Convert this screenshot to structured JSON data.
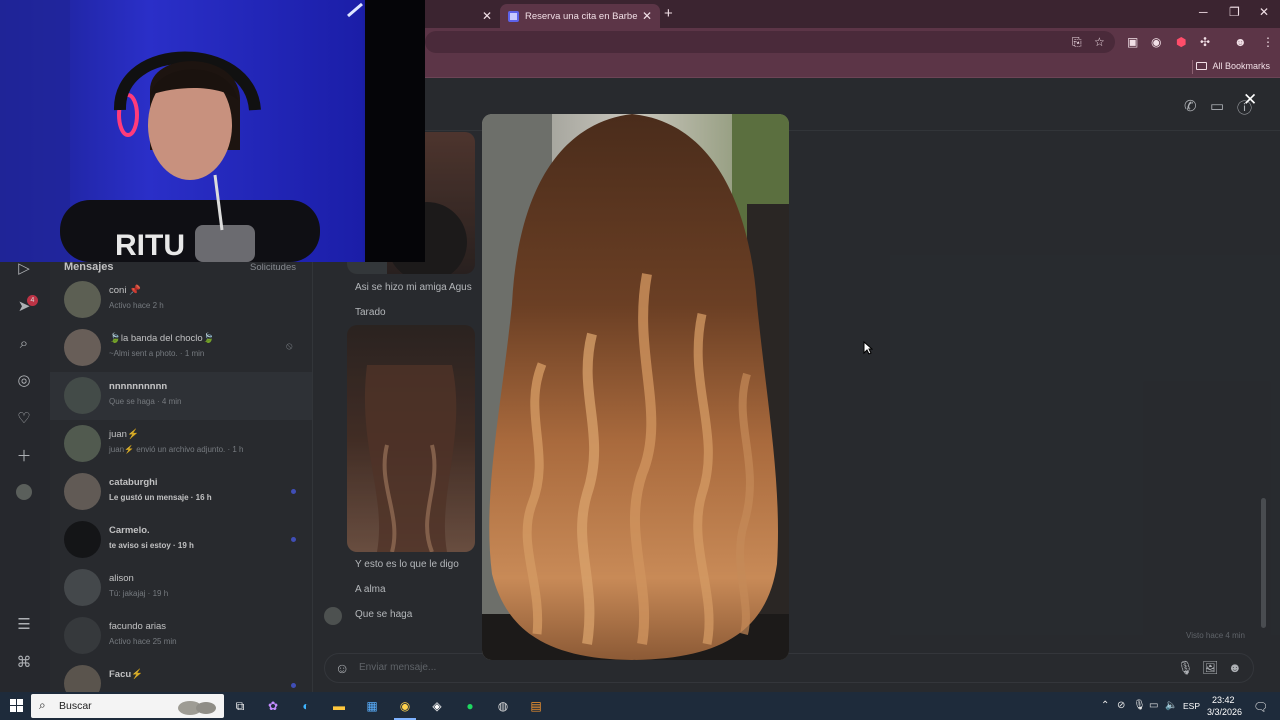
{
  "browser": {
    "tabs": [
      {
        "title": ""
      },
      {
        "title": "Reserva una cita en Barbería D…"
      }
    ],
    "new_tab": "+",
    "bookmarks_all": "All Bookmarks"
  },
  "inbox": {
    "title": "Mensajes",
    "requests": "Solicitudes",
    "conversations": [
      {
        "name": "coni 📌",
        "sub": "Activo hace 2 h",
        "bold": false,
        "unread": false
      },
      {
        "name": "🍃la banda del choclo🍃",
        "sub": "~Almi sent a photo. · 1 min",
        "bold": false,
        "unread": false,
        "muted": true
      },
      {
        "name": "𝐧𝐧𝐧𝐧𝐧𝐧𝐧𝐧𝐧𝐧",
        "sub": "Que se haga · 4 min",
        "bold": false,
        "unread": false
      },
      {
        "name": "juan⚡",
        "sub": "juan⚡ envió un archivo adjunto. · 1 h",
        "bold": false,
        "unread": false
      },
      {
        "name": "cataburghi",
        "sub": "Le gustó un mensaje · 16 h",
        "bold": true,
        "unread": true
      },
      {
        "name": "Carmelo.",
        "sub": "te aviso si estoy · 19 h",
        "bold": true,
        "unread": true
      },
      {
        "name": "alison",
        "sub": "Tú: jakajaj · 19 h",
        "bold": false,
        "unread": false
      },
      {
        "name": "facundo arias",
        "sub": "Activo hace 25 min",
        "bold": false,
        "unread": false
      },
      {
        "name": "Facu⚡",
        "sub": "",
        "bold": true,
        "unread": true
      }
    ]
  },
  "chat": {
    "messages": [
      "Asi se hizo mi amiga Agus",
      "Tarado",
      "Y esto es lo que le digo",
      "A alma",
      "Que se haga"
    ],
    "seen": "Visto hace 4 min",
    "composer_placeholder": "Enviar mensaje..."
  },
  "lightbox": {
    "close": "✕"
  },
  "taskbar": {
    "search_placeholder": "Buscar",
    "language": "ESP",
    "time": "23:42",
    "date": "3/3/2026"
  },
  "webcam": {
    "shirt_text": "RITU"
  },
  "colors": {
    "tab_bar": "#3b2430",
    "toolbar": "#5c3547",
    "page_bg": "#2c2f33",
    "taskbar": "#1e2b3b",
    "unread_dot": "#4a5bd8",
    "notif_badge": "#e13a4f"
  }
}
